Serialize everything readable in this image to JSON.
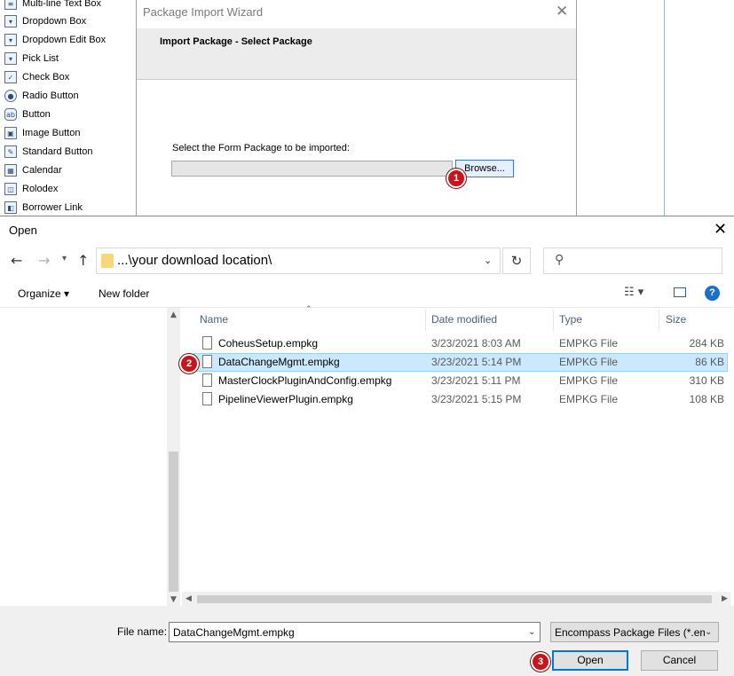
{
  "toolbox": {
    "items": [
      {
        "label": "Multi-line Text Box",
        "icon": "multiline-textbox-icon"
      },
      {
        "label": "Dropdown Box",
        "icon": "dropdown-box-icon"
      },
      {
        "label": "Dropdown Edit Box",
        "icon": "dropdown-edit-box-icon"
      },
      {
        "label": "Pick List",
        "icon": "pick-list-icon"
      },
      {
        "label": "Check Box",
        "icon": "check-box-icon"
      },
      {
        "label": "Radio Button",
        "icon": "radio-button-icon"
      },
      {
        "label": "Button",
        "icon": "button-icon"
      },
      {
        "label": "Image Button",
        "icon": "image-button-icon"
      },
      {
        "label": "Standard Button",
        "icon": "standard-button-icon"
      },
      {
        "label": "Calendar",
        "icon": "calendar-icon"
      },
      {
        "label": "Rolodex",
        "icon": "rolodex-icon"
      },
      {
        "label": "Borrower Link",
        "icon": "borrower-link-icon"
      }
    ]
  },
  "wizard": {
    "title": "Package Import Wizard",
    "close_glyph": "✕",
    "header": "Import Package - Select Package",
    "prompt": "Select the Form Package to be imported:",
    "package_path": "",
    "browse_label": "Browse...",
    "step_badge": "1"
  },
  "open_dialog": {
    "title": "Open",
    "close_glyph": "✕",
    "address": "...\\your download location\\",
    "search_placeholder": "",
    "toolbar": {
      "organize_label": "Organize ▾",
      "new_folder_label": "New folder"
    },
    "columns": {
      "name": "Name",
      "date_modified": "Date modified",
      "type": "Type",
      "size": "Size"
    },
    "files": [
      {
        "name": "CoheusSetup.empkg",
        "date": "3/23/2021 8:03 AM",
        "type": "EMPKG File",
        "size": "284 KB",
        "selected": false
      },
      {
        "name": "DataChangeMgmt.empkg",
        "date": "3/23/2021 5:14 PM",
        "type": "EMPKG File",
        "size": "86 KB",
        "selected": true
      },
      {
        "name": "MasterClockPluginAndConfig.empkg",
        "date": "3/23/2021 5:11 PM",
        "type": "EMPKG File",
        "size": "310 KB",
        "selected": false
      },
      {
        "name": "PipelineViewerPlugin.empkg",
        "date": "3/23/2021 5:15 PM",
        "type": "EMPKG File",
        "size": "108 KB",
        "selected": false
      }
    ],
    "selected_badge": "2",
    "file_name_label": "File name:",
    "file_name_value": "DataChangeMgmt.empkg",
    "filter_value": "Encompass Package Files (*.em",
    "open_label": "Open",
    "cancel_label": "Cancel",
    "open_badge": "3"
  },
  "colors": {
    "selection": "#cce8ff",
    "badge": "#c8141b",
    "accent": "#0078d7"
  }
}
